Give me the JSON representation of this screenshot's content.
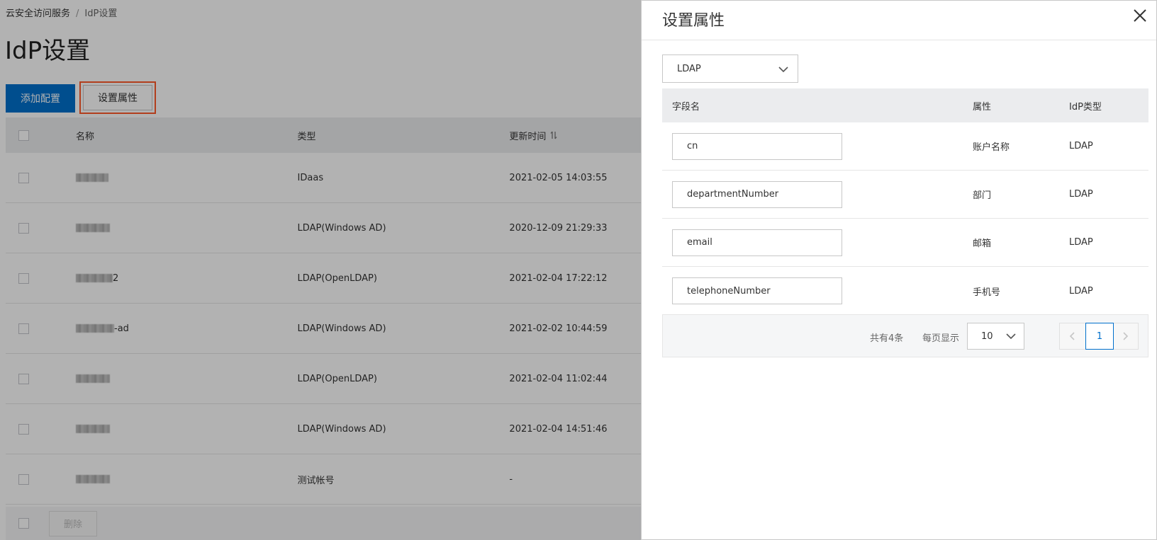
{
  "breadcrumb": {
    "parent": "云安全访问服务",
    "separator": "/",
    "current": "IdP设置"
  },
  "page_title": "IdP设置",
  "toolbar": {
    "add_label": "添加配置",
    "attr_label": "设置属性"
  },
  "table": {
    "headers": {
      "name": "名称",
      "type": "类型",
      "time": "更新时间"
    },
    "rows": [
      {
        "name_suffix": "",
        "type": "IDaas",
        "time": "2021-02-05 14:03:55"
      },
      {
        "name_suffix": "",
        "type": "LDAP(Windows AD)",
        "time": "2020-12-09 21:29:33"
      },
      {
        "name_suffix": "2",
        "type": "LDAP(OpenLDAP)",
        "time": "2021-02-04 17:22:12"
      },
      {
        "name_suffix": "-ad",
        "type": "LDAP(Windows AD)",
        "time": "2021-02-02 10:44:59"
      },
      {
        "name_suffix": "",
        "type": "LDAP(OpenLDAP)",
        "time": "2021-02-04 11:02:44"
      },
      {
        "name_suffix": "",
        "type": "LDAP(Windows AD)",
        "time": "2021-02-04 14:51:46"
      },
      {
        "name_suffix": "",
        "type": "测试帐号",
        "time": "-"
      }
    ],
    "delete_label": "删除"
  },
  "drawer": {
    "title": "设置属性",
    "select_value": "LDAP",
    "headers": {
      "field": "字段名",
      "attr": "属性",
      "type": "IdP类型"
    },
    "rows": [
      {
        "field": "cn",
        "attr": "账户名称",
        "type": "LDAP"
      },
      {
        "field": "departmentNumber",
        "attr": "部门",
        "type": "LDAP"
      },
      {
        "field": "email",
        "attr": "邮箱",
        "type": "LDAP"
      },
      {
        "field": "telephoneNumber",
        "attr": "手机号",
        "type": "LDAP"
      }
    ],
    "pagination": {
      "total": "共有4条",
      "size_label": "每页显示",
      "size_value": "10",
      "current_page": "1"
    }
  },
  "colors": {
    "primary": "#0070cc",
    "highlight": "#ff5a2a",
    "overlay": "rgba(0,0,0,0.30)"
  },
  "icons": [
    "close-icon",
    "chevron-down-icon",
    "sort-icon",
    "chevron-left-icon",
    "chevron-right-icon"
  ]
}
